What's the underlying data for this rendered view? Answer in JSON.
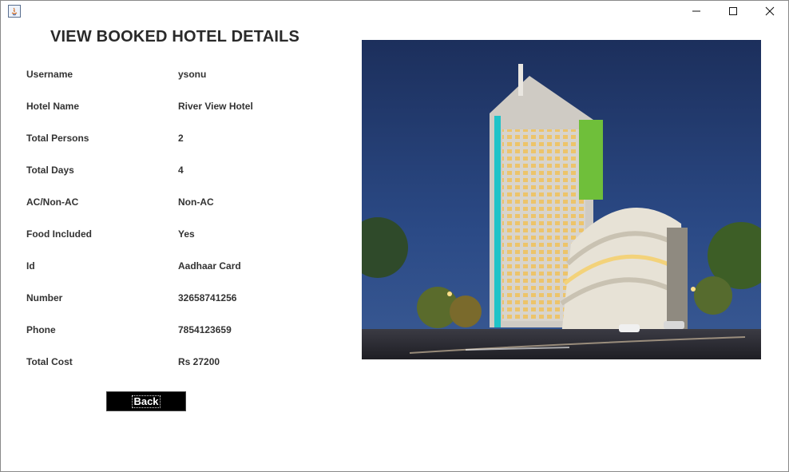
{
  "window": {
    "app_icon": "java-app-icon",
    "controls": [
      "minimize-icon",
      "maximize-icon",
      "close-icon"
    ]
  },
  "page": {
    "title": "VIEW BOOKED HOTEL DETAILS"
  },
  "details": [
    {
      "label": "Username",
      "value": "ysonu"
    },
    {
      "label": "Hotel Name",
      "value": "River View Hotel"
    },
    {
      "label": "Total Persons",
      "value": "2"
    },
    {
      "label": "Total Days",
      "value": "4"
    },
    {
      "label": "AC/Non-AC",
      "value": "Non-AC"
    },
    {
      "label": "Food Included",
      "value": "Yes"
    },
    {
      "label": "Id",
      "value": "Aadhaar Card"
    },
    {
      "label": "Number",
      "value": "32658741256"
    },
    {
      "label": "Phone",
      "value": "7854123659"
    },
    {
      "label": "Total Cost",
      "value": "Rs 27200"
    }
  ],
  "actions": {
    "back_label": "Back"
  },
  "colors": {
    "button_bg": "#000000",
    "button_text": "#ffffff",
    "text": "#333333",
    "sky": "#1d3566"
  }
}
